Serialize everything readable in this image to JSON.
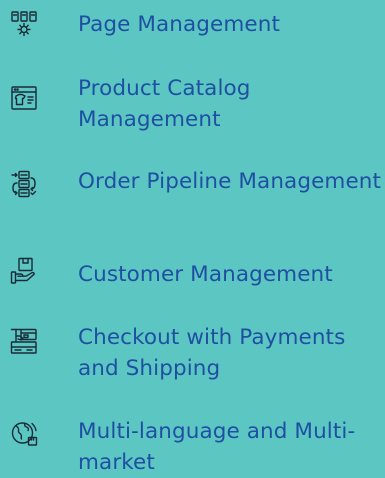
{
  "theme": {
    "background": "#5cc7c2",
    "text_color": "#1f4fa3",
    "icon_color": "#1b2a38"
  },
  "features": [
    {
      "icon": "page-management-icon",
      "label": "Page Management"
    },
    {
      "icon": "product-catalog-icon",
      "label": "Product Catalog Management"
    },
    {
      "icon": "order-pipeline-icon",
      "label": "Order Pipeline Management"
    },
    {
      "icon": "customer-management-icon",
      "label": "Customer Management"
    },
    {
      "icon": "checkout-payments-icon",
      "label": "Checkout with Payments and Shipping"
    },
    {
      "icon": "multi-language-globe-icon",
      "label": "Multi-language and Multi-market"
    }
  ]
}
